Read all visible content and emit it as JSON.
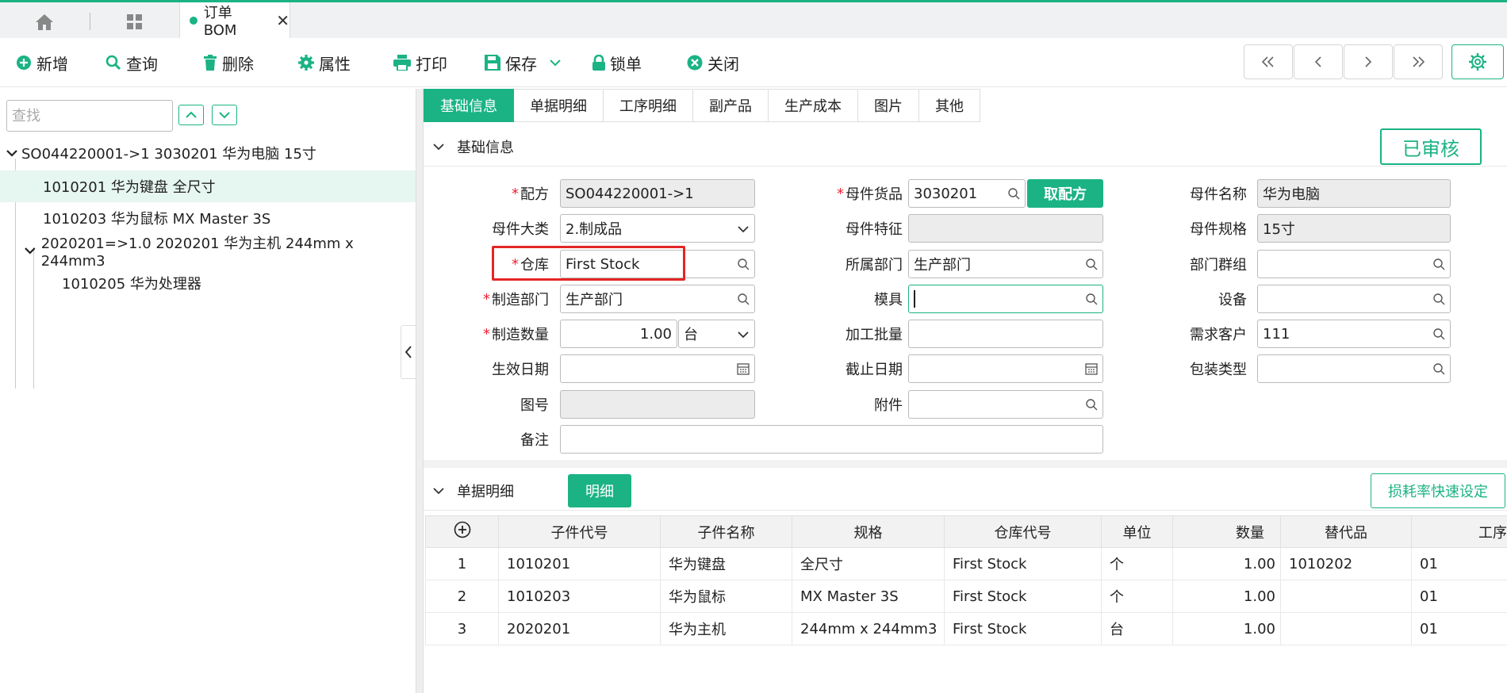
{
  "top_tab": {
    "label": "订单BOM",
    "close": "✕"
  },
  "toolbar": {
    "add": "新增",
    "query": "查询",
    "delete": "删除",
    "properties": "属性",
    "print": "打印",
    "save": "保存",
    "lock": "锁单",
    "close": "关闭"
  },
  "left": {
    "search_placeholder": "查找",
    "tree": [
      {
        "label": "SO044220001->1 3030201 华为电脑 15寸"
      },
      {
        "label": "1010201 华为键盘 全尺寸"
      },
      {
        "label": "1010203 华为鼠标 MX Master 3S"
      },
      {
        "label": "2020201=>1.0 2020201 华为主机 244mm x 244mm3"
      },
      {
        "label": "1010205 华为处理器"
      }
    ]
  },
  "tabs": [
    "基础信息",
    "单据明细",
    "工序明细",
    "副产品",
    "生产成本",
    "图片",
    "其他"
  ],
  "basic": {
    "title": "基础信息",
    "status": "已审核",
    "labels": {
      "recipe": "配方",
      "parent_goods": "母件货品",
      "parent_name": "母件名称",
      "parent_class": "母件大类",
      "parent_feature": "母件特征",
      "parent_spec": "母件规格",
      "warehouse": "仓库",
      "dept": "所属部门",
      "dept_group": "部门群组",
      "mfg_dept": "制造部门",
      "mold": "模具",
      "equipment": "设备",
      "mfg_qty": "制造数量",
      "batch": "加工批量",
      "customer": "需求客户",
      "start_date": "生效日期",
      "end_date": "截止日期",
      "pack_type": "包装类型",
      "drawing_no": "图号",
      "attachment": "附件",
      "remark": "备注"
    },
    "values": {
      "recipe": "SO044220001->1",
      "parent_goods": "3030201",
      "parent_name": "华为电脑",
      "parent_class": "2.制成品",
      "parent_feature": "",
      "parent_spec": "15寸",
      "warehouse": "First Stock",
      "dept": "生产部门",
      "dept_group": "",
      "mfg_dept": "生产部门",
      "mold": "",
      "equipment": "",
      "mfg_qty": "1.00",
      "unit": "台",
      "batch": "",
      "customer": "111",
      "start_date": "",
      "end_date": "",
      "pack_type": "",
      "drawing_no": "",
      "attachment": "",
      "remark": ""
    },
    "get_recipe_btn": "取配方"
  },
  "detail": {
    "title": "单据明细",
    "detail_btn": "明细",
    "loss_btn": "损耗率快速设定",
    "columns": [
      "子件代号",
      "子件名称",
      "规格",
      "仓库代号",
      "单位",
      "数量",
      "替代品",
      "工序"
    ],
    "rows": [
      {
        "no": "1",
        "code": "1010201",
        "name": "华为键盘",
        "spec": "全尺寸",
        "wh": "First Stock",
        "unit": "个",
        "qty": "1.00",
        "sub": "1010202",
        "proc": "01"
      },
      {
        "no": "2",
        "code": "1010203",
        "name": "华为鼠标",
        "spec": "MX Master 3S",
        "wh": "First Stock",
        "unit": "个",
        "qty": "1.00",
        "sub": "",
        "proc": "01"
      },
      {
        "no": "3",
        "code": "2020201",
        "name": "华为主机",
        "spec": "244mm x 244mm3",
        "wh": "First Stock",
        "unit": "台",
        "qty": "1.00",
        "sub": "",
        "proc": "01"
      }
    ]
  },
  "colors": {
    "accent": "#1bb384",
    "highlight": "#e52525",
    "required": "#e22233"
  }
}
